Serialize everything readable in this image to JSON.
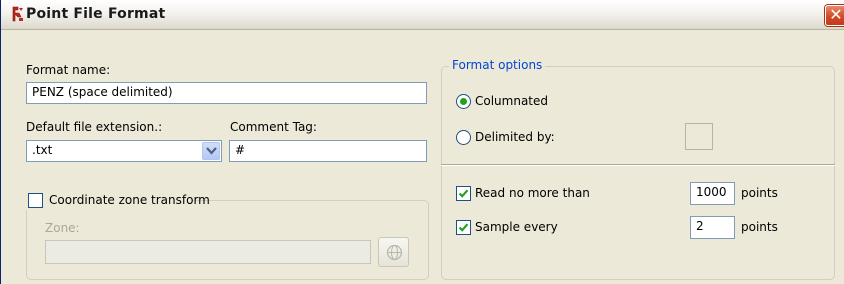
{
  "window": {
    "title": "Point File Format",
    "close_symbol": "✕"
  },
  "format_name": {
    "label": "Format name:",
    "value": "PENZ (space delimited)"
  },
  "file_extension": {
    "label": "Default file extension.:",
    "value": ".txt"
  },
  "comment_tag": {
    "label": "Comment Tag:",
    "value": "#"
  },
  "coordinate_zone": {
    "checkbox_label": "Coordinate zone transform",
    "checked": false,
    "zone_label": "Zone:",
    "zone_value": ""
  },
  "format_options": {
    "group_title": "Format options",
    "columnated_label": "Columnated",
    "columnated_selected": true,
    "delimited_label": "Delimited by:",
    "delimited_selected": false,
    "delimiter_value": ""
  },
  "read_limit": {
    "checkbox_label": "Read no more than",
    "checked": true,
    "value": "1000",
    "unit": "points"
  },
  "sample": {
    "checkbox_label": "Sample every",
    "checked": true,
    "value": "2",
    "unit": "points"
  },
  "colors": {
    "accent_blue": "#0046d5",
    "checkbox_green": "#21a121",
    "close_red": "#d24a28"
  }
}
